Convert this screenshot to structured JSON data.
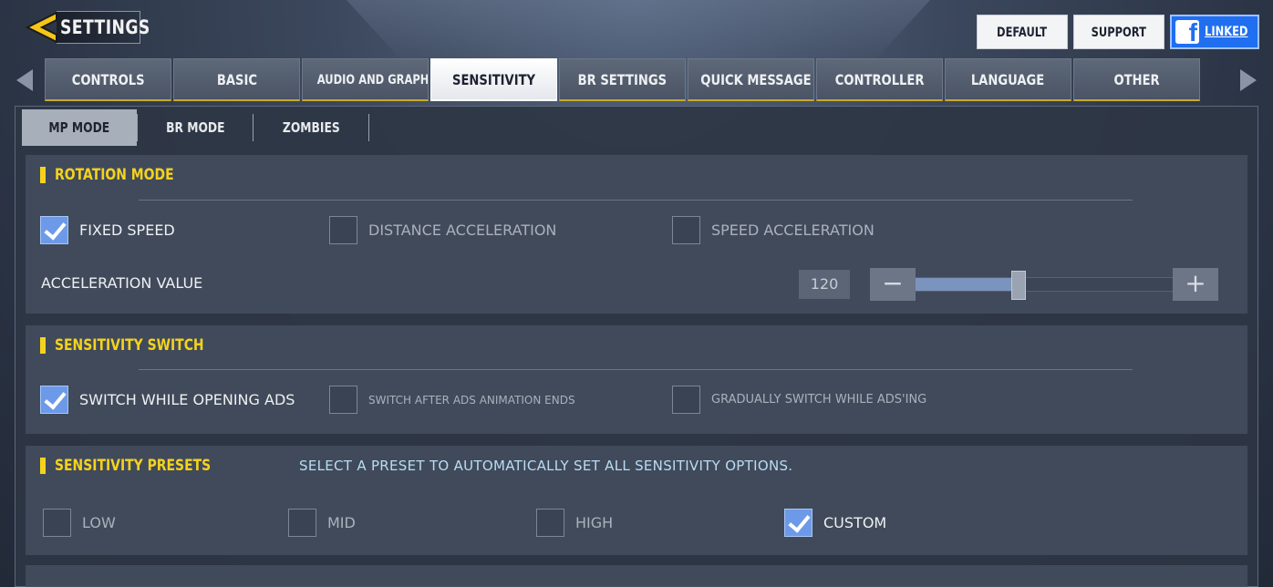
{
  "header": {
    "title": "SETTINGS",
    "buttons": {
      "default": "DEFAULT",
      "support": "SUPPORT",
      "linked": "LINKED"
    }
  },
  "tabs": [
    {
      "label": "CONTROLS",
      "active": false
    },
    {
      "label": "BASIC",
      "active": false
    },
    {
      "label": "AUDIO AND GRAPHICS",
      "active": false
    },
    {
      "label": "SENSITIVITY",
      "active": true
    },
    {
      "label": "BR SETTINGS",
      "active": false
    },
    {
      "label": "QUICK MESSAGE",
      "active": false
    },
    {
      "label": "CONTROLLER",
      "active": false
    },
    {
      "label": "LANGUAGE",
      "active": false
    },
    {
      "label": "OTHER",
      "active": false
    }
  ],
  "subtabs": [
    {
      "label": "MP MODE",
      "active": true
    },
    {
      "label": "BR MODE",
      "active": false
    },
    {
      "label": "ZOMBIES",
      "active": false
    }
  ],
  "rotation_mode": {
    "title": "ROTATION MODE",
    "options": [
      {
        "label": "FIXED SPEED",
        "checked": true
      },
      {
        "label": "DISTANCE ACCELERATION",
        "checked": false
      },
      {
        "label": "SPEED ACCELERATION",
        "checked": false
      }
    ],
    "acceleration": {
      "label": "ACCELERATION VALUE",
      "value": "120",
      "slider_fraction": 0.4
    }
  },
  "sensitivity_switch": {
    "title": "SENSITIVITY SWITCH",
    "options": [
      {
        "label": "SWITCH WHILE OPENING ADS",
        "checked": true
      },
      {
        "label": "SWITCH AFTER ADS ANIMATION ENDS",
        "checked": false
      },
      {
        "label": "GRADUALLY SWITCH WHILE ADS'ING",
        "checked": false
      }
    ]
  },
  "sensitivity_presets": {
    "title": "SENSITIVITY PRESETS",
    "description": "SELECT A PRESET TO AUTOMATICALLY SET ALL SENSITIVITY OPTIONS.",
    "options": [
      {
        "label": "LOW",
        "checked": false
      },
      {
        "label": "MID",
        "checked": false
      },
      {
        "label": "HIGH",
        "checked": false
      },
      {
        "label": "CUSTOM",
        "checked": true
      }
    ]
  },
  "colors": {
    "accent_yellow": "#f5d21e",
    "check_blue": "#6d9ae8",
    "facebook_blue": "#1f6ff0"
  },
  "icons": {
    "back": "back-arrow-icon",
    "facebook": "facebook-icon",
    "prev": "chevron-left-icon",
    "next": "chevron-right-icon"
  }
}
